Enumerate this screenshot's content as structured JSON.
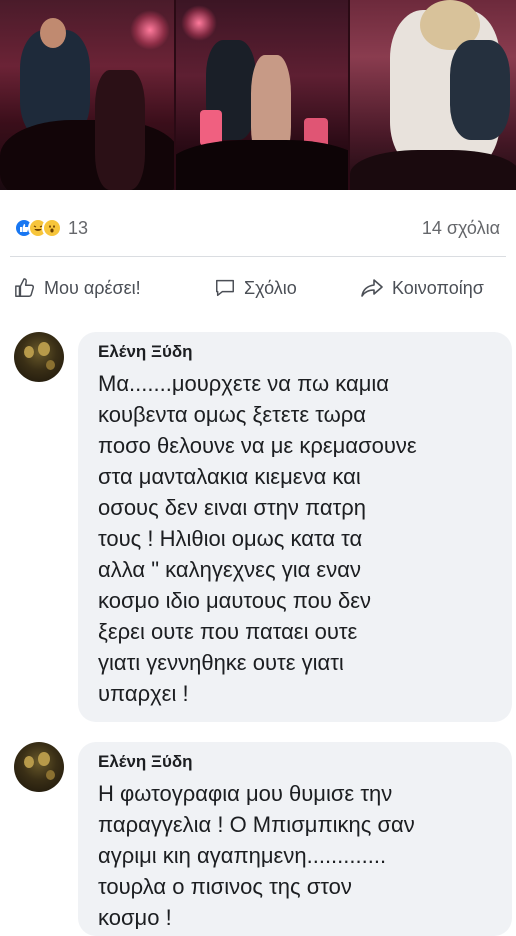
{
  "post": {
    "reactions": {
      "icons": [
        "like-icon",
        "haha-icon",
        "wow-icon"
      ],
      "count": "13"
    },
    "comments_count": "14 σχόλια"
  },
  "actions": {
    "like": "Μου αρέσει!",
    "comment": "Σχόλιο",
    "share": "Κοινοποίησ"
  },
  "comments": [
    {
      "author": "Ελένη Ξύδη",
      "text": "Μα.......μουρχετε να πω καμια\nκουβεντα ομως ξετετε τωρα\nποσο θελουνε να με κρεμασουνε\nστα μανταλακια κιεμενα και\nοσους δεν ειναι στην πατρη\nτους !  Ηλιθιοι ομως κατα τα\nαλλα \" καληγεχνες για εναν\nκοσμο ιδιο μαυτους που δεν\nξερει ουτε που παταει ουτε\nγιατι γεννηθηκε  ουτε γιατι\nυπαρχει !"
    },
    {
      "author": "Ελένη Ξύδη",
      "text": "Η φωτογραφια μου θυμισε την\nπαραγγελια ! Ο Μπισμπικης σαν\nαγριμι κιη αγαπημενη.............\nτουρλα ο πισινος της στον\nκοσμο !"
    }
  ]
}
